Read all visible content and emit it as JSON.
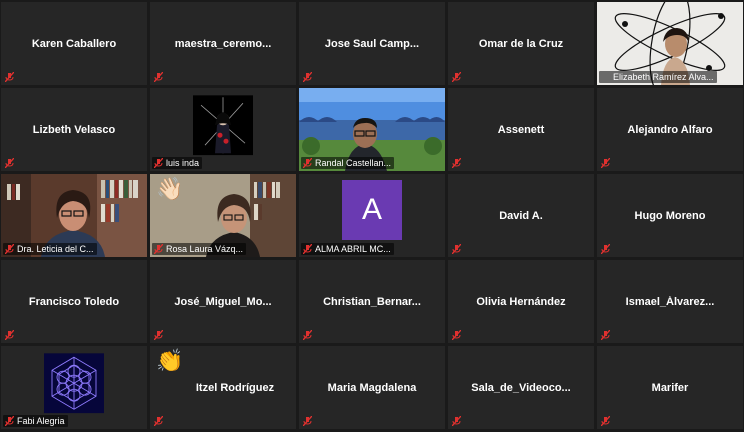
{
  "colors": {
    "tile_bg": "#262626",
    "active_border": "#e5e048",
    "muted_icon": "#e0312f",
    "avatar_purple": "#6a3ab2"
  },
  "participants": [
    {
      "name": "Karen Caballero",
      "style": "center"
    },
    {
      "name": "maestra_ceremo...",
      "style": "center"
    },
    {
      "name": "Jose Saul Camp...",
      "style": "center"
    },
    {
      "name": "Omar de la Cruz",
      "style": "center"
    },
    {
      "name": "Elizabeth Ramírez Alva...",
      "style": "video",
      "active": true
    },
    {
      "name": "Lizbeth Velasco",
      "style": "center"
    },
    {
      "name": "luis inda",
      "style": "image"
    },
    {
      "name": "Randal Castellan...",
      "style": "video"
    },
    {
      "name": "Assenett",
      "style": "center"
    },
    {
      "name": "Alejandro Alfaro",
      "style": "center"
    },
    {
      "name": "Dra. Leticia del C...",
      "style": "video"
    },
    {
      "name": "Rosa Laura Vázq...",
      "style": "video",
      "emoji": "👋🏻"
    },
    {
      "name": "ALMA ABRIL MC...",
      "style": "avatar",
      "avatar_letter": "A"
    },
    {
      "name": "David A.",
      "style": "center"
    },
    {
      "name": "Hugo Moreno",
      "style": "center"
    },
    {
      "name": "Francisco Toledo",
      "style": "center"
    },
    {
      "name": "José_Miguel_Mo...",
      "style": "center"
    },
    {
      "name": "Christian_Bernar...",
      "style": "center"
    },
    {
      "name": "Olivia Hernández",
      "style": "center"
    },
    {
      "name": "Ismael_Álvarez...",
      "style": "center"
    },
    {
      "name": "Fabi Alegria",
      "style": "image"
    },
    {
      "name": "Itzel Rodríguez",
      "style": "center",
      "emoji": "👏"
    },
    {
      "name": "Maria Magdalena",
      "style": "center"
    },
    {
      "name": "Sala_de_Videoco...",
      "style": "center"
    },
    {
      "name": "Marifer",
      "style": "center"
    }
  ]
}
